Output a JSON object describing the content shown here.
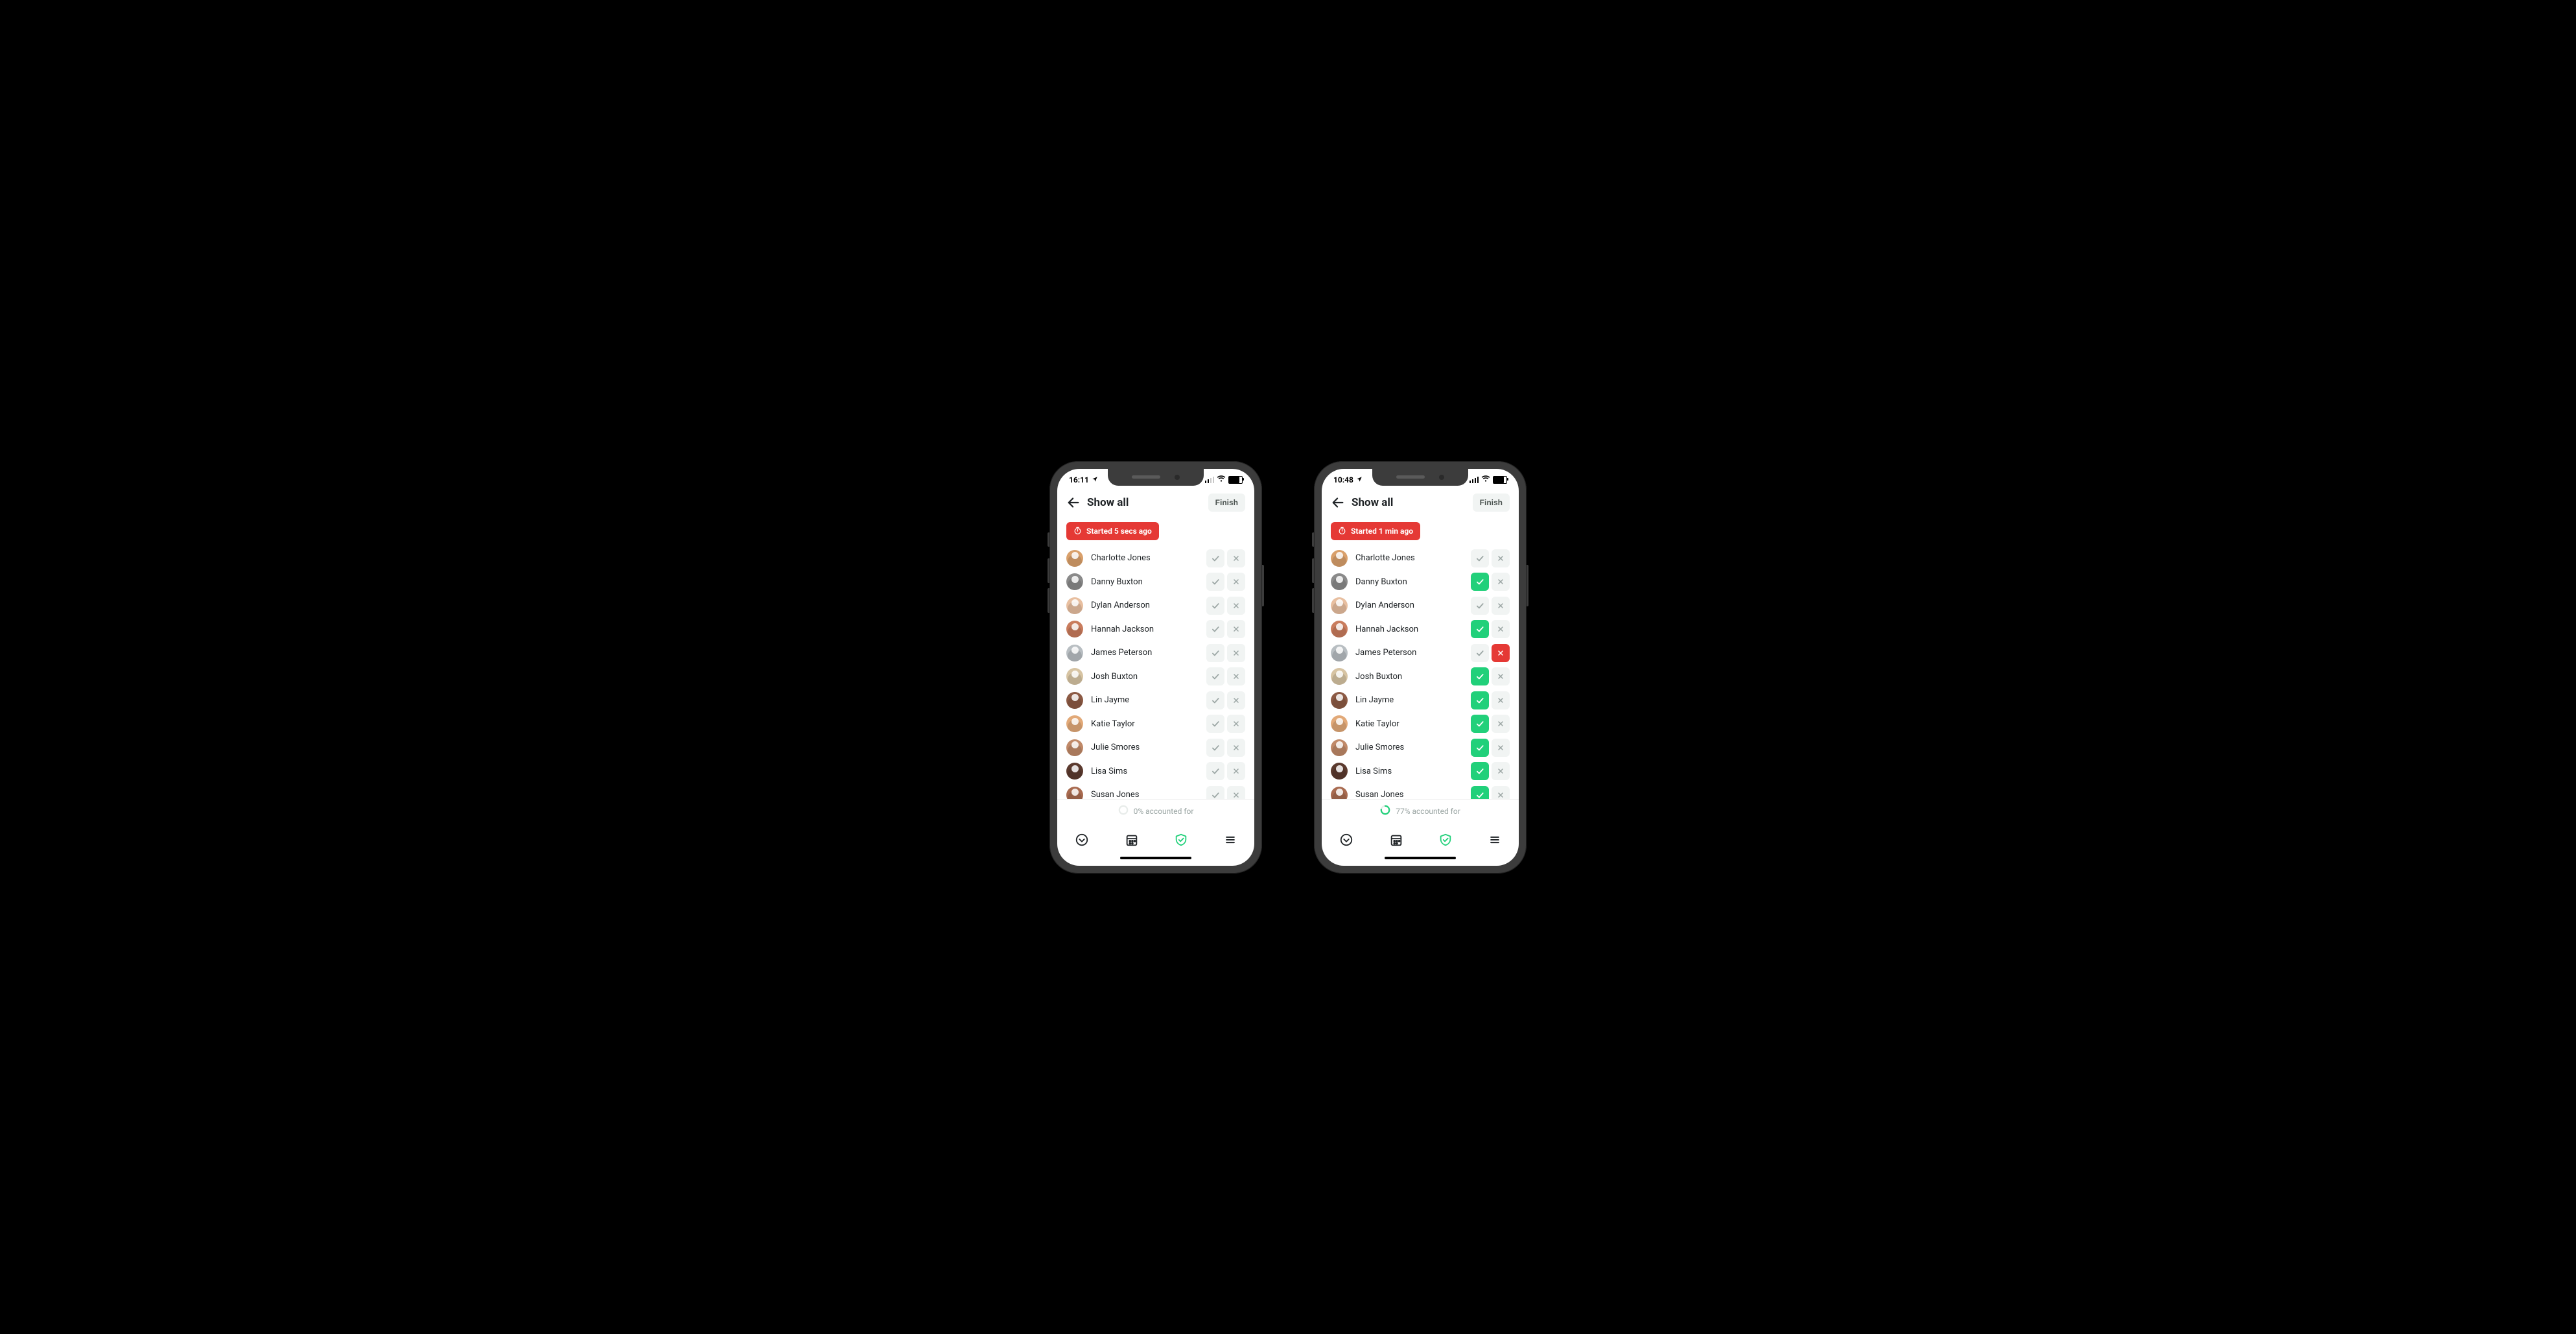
{
  "people": [
    {
      "name": "Charlotte Jones",
      "color": "#D9A06B"
    },
    {
      "name": "Danny Buxton",
      "color": "#8A8A8A"
    },
    {
      "name": "Dylan Anderson",
      "color": "#E8BFA0"
    },
    {
      "name": "Hannah Jackson",
      "color": "#C97C5D"
    },
    {
      "name": "James Peterson",
      "color": "#B8BEC2"
    },
    {
      "name": "Josh Buxton",
      "color": "#D7C4A3"
    },
    {
      "name": "Lin Jayme",
      "color": "#8C5A44"
    },
    {
      "name": "Katie Taylor",
      "color": "#E2A978"
    },
    {
      "name": "Julie Smores",
      "color": "#C08968"
    },
    {
      "name": "Lisa Sims",
      "color": "#5B3A2E"
    },
    {
      "name": "Susan Jones",
      "color": "#A86A4F"
    }
  ],
  "phones": [
    {
      "status_time": "16:11",
      "status_signal": "weak",
      "title": "Show all",
      "finish_label": "Finish",
      "started_label": "Started 5 secs ago",
      "states": [
        "",
        "",
        "",
        "",
        "",
        "",
        "",
        "",
        "",
        "",
        ""
      ],
      "progress_pct": 0,
      "progress_text": "0% accounted for"
    },
    {
      "status_time": "10:48",
      "status_signal": "full",
      "title": "Show all",
      "finish_label": "Finish",
      "started_label": "Started 1 min ago",
      "states": [
        "",
        "check",
        "",
        "check",
        "cross",
        "check",
        "check",
        "check",
        "check",
        "check",
        "check"
      ],
      "progress_pct": 77,
      "progress_text": "77% accounted for"
    }
  ],
  "icons": {
    "active_tab": "shield"
  }
}
